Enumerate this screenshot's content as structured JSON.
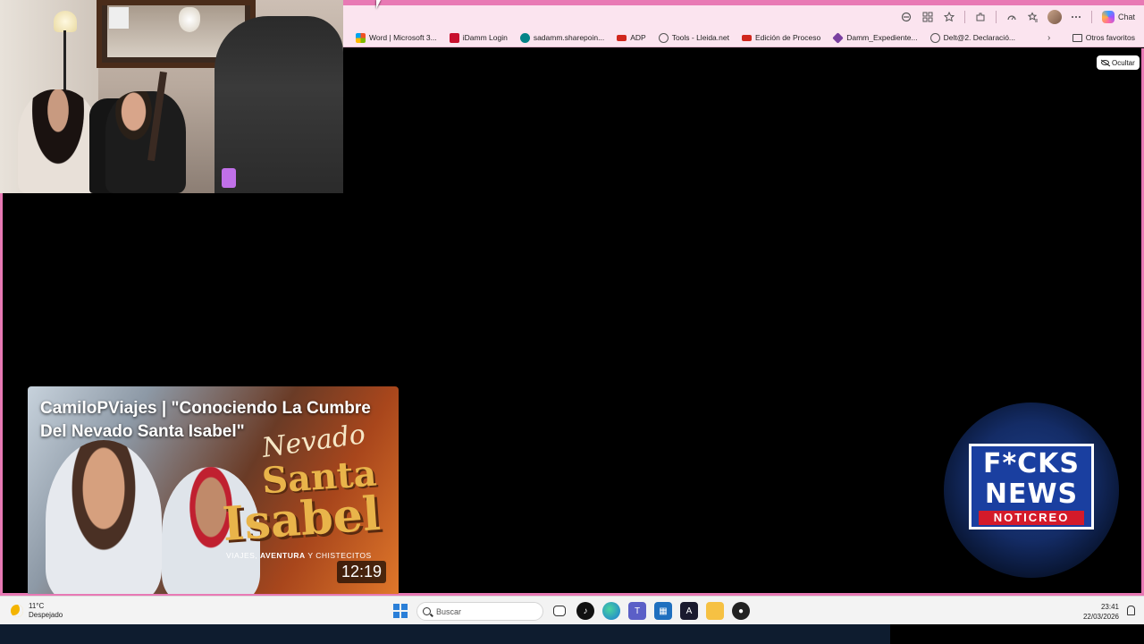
{
  "browser": {
    "toolbar": {
      "chat_label": "Chat"
    },
    "bookmarks": [
      {
        "label": "Word | Microsoft 3...",
        "color": "#2b579a"
      },
      {
        "label": "iDamm Login",
        "color": "#c8102e"
      },
      {
        "label": "sadamm.sharepoin...",
        "color": "#038387"
      },
      {
        "label": "ADP",
        "color": "#d0271d"
      },
      {
        "label": "Tools - Lleida.net",
        "color": "#555555"
      },
      {
        "label": "Edición de Proceso",
        "color": "#d0271d"
      },
      {
        "label": "Damm_Expediente...",
        "color": "#7a3fa0"
      },
      {
        "label": "Delt@2. Declaració...",
        "color": "#555555"
      }
    ],
    "other_bookmarks": "Otros favoritos"
  },
  "overlay": {
    "hide_button": "Ocultar"
  },
  "video_card": {
    "title": "CamiloPViajes | \"Conociendo La Cumbre Del Nevado Santa Isabel\"",
    "thumb_text_1": "Nevado",
    "thumb_text_2": "Santa",
    "thumb_text_3": "Isabel",
    "tagline_a": "VIAJES, ",
    "tagline_b": "AVENTURA",
    "tagline_c": " Y CHISTECITOS",
    "duration": "12:19"
  },
  "news_logo": {
    "line1": "F*CKS",
    "line2": "NEWS",
    "sub": "NOTICREO"
  },
  "taskbar": {
    "temperature": "11°C",
    "weather": "Despejado",
    "search_placeholder": "Buscar",
    "time": "23:41",
    "date": "22/03/2026"
  },
  "colors": {
    "frame_pink": "#e879b4",
    "toolbar_bg": "#fbe4ef"
  }
}
